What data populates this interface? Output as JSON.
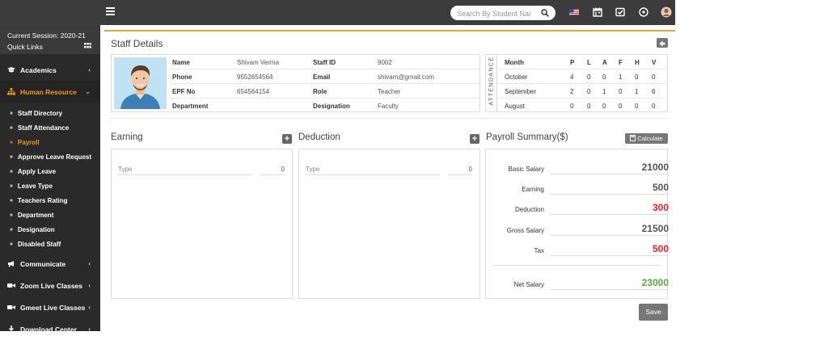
{
  "topbar": {
    "search_placeholder": "Search By Student Name",
    "icons": [
      "menu-icon",
      "search-icon",
      "flag-icon",
      "calendar-icon",
      "checkbox-icon",
      "whatsapp-icon",
      "user-avatar"
    ]
  },
  "sidebar": {
    "session": "Current Session: 2020-21",
    "quick_links": "Quick Links",
    "nav": {
      "academics": "Academics",
      "human_resource": "Human Resource",
      "communicate": "Communicate",
      "zoom": "Zoom Live Classes",
      "gmeet": "Gmeet Live Classes",
      "download": "Download Center"
    },
    "sub": [
      "Staff Directory",
      "Staff Attendance",
      "Payroll",
      "Approve Leave Request",
      "Apply Leave",
      "Leave Type",
      "Teachers Rating",
      "Department",
      "Designation",
      "Disabled Staff"
    ],
    "accent_color": "#f39c12"
  },
  "staff": {
    "section_title": "Staff Details",
    "name_label": "Name",
    "name": "Shivam Verma",
    "staff_id_label": "Staff ID",
    "staff_id": "9002",
    "phone_label": "Phone",
    "phone": "9552654564",
    "email_label": "Email",
    "email": "shivam@gmail.com",
    "epf_label": "EPF No",
    "epf": "654564154",
    "role_label": "Role",
    "role": "Teacher",
    "department_label": "Department",
    "department": "",
    "designation_label": "Designation",
    "designation": "Faculty"
  },
  "attendance": {
    "vertical_label": "ATTENDANCE",
    "headers": [
      "Month",
      "P",
      "L",
      "A",
      "F",
      "H",
      "V"
    ],
    "rows": [
      [
        "October",
        "4",
        "0",
        "0",
        "1",
        "0",
        "0"
      ],
      [
        "September",
        "2",
        "0",
        "1",
        "0",
        "1",
        "6"
      ],
      [
        "August",
        "0",
        "0",
        "0",
        "0",
        "0",
        "0"
      ]
    ]
  },
  "earning": {
    "title": "Earning",
    "type_placeholder": "Type",
    "amount": "0"
  },
  "deduction": {
    "title": "Deduction",
    "type_placeholder": "Type",
    "amount": "0"
  },
  "summary": {
    "title": "Payroll Summary($)",
    "calculate": "Calculate",
    "rows": [
      {
        "label": "Basic Salary",
        "value": "21000",
        "color": "#555555"
      },
      {
        "label": "Earning",
        "value": "500",
        "color": "#555555"
      },
      {
        "label": "Deduction",
        "value": "300",
        "color": "#e8202a"
      },
      {
        "label": "Gross Salary",
        "value": "21500",
        "color": "#555555"
      },
      {
        "label": "Tax",
        "value": "500",
        "color": "#e8202a"
      },
      {
        "label": "Net Salary",
        "value": "23000",
        "color": "#5aa83c"
      }
    ],
    "save": "Save"
  }
}
